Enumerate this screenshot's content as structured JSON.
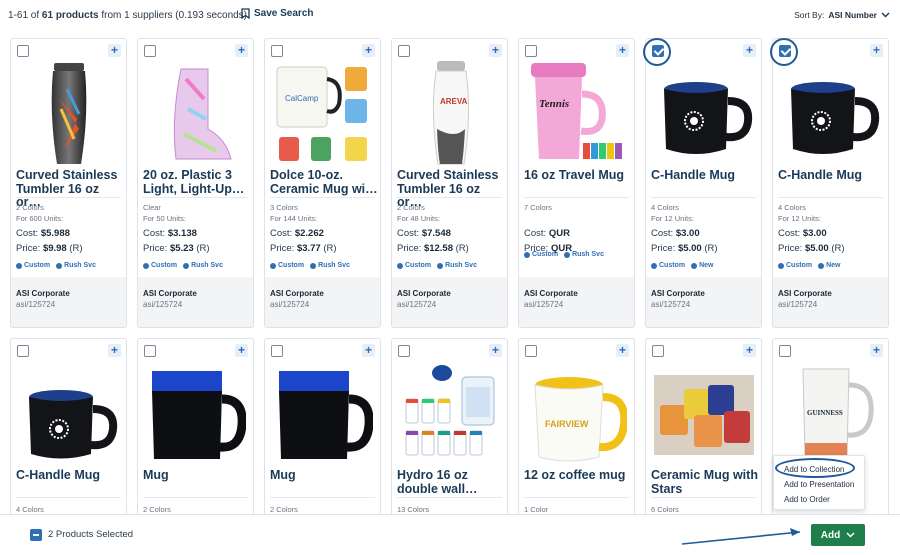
{
  "header": {
    "results_range": "1-61 of",
    "results_count": "61 products",
    "results_suffix": "from 1 suppliers (0.193 seconds)",
    "save_search_label": "Save Search",
    "sort_label": "Sort By:",
    "sort_value": "ASI Number"
  },
  "products": [
    {
      "title": "Curved Stainless Tumbler 16 oz or…",
      "colors": "2 Colors",
      "units": "For 600 Units:",
      "cost_label": "Cost:",
      "cost": "$5.988",
      "price_label": "Price:",
      "price": "$9.98",
      "price_note": "(R)",
      "tags": [
        "Custom",
        "Rush Svc"
      ],
      "supplier": "ASI Corporate",
      "asi": "asi/125724",
      "checked": false
    },
    {
      "title": "20 oz. Plastic 3 Light, Light-Up…",
      "colors": "Clear",
      "units": "For 50 Units:",
      "cost_label": "Cost:",
      "cost": "$3.138",
      "price_label": "Price:",
      "price": "$5.23",
      "price_note": "(R)",
      "tags": [
        "Custom",
        "Rush Svc"
      ],
      "supplier": "ASI Corporate",
      "asi": "asi/125724",
      "checked": false
    },
    {
      "title": "Dolce 10-oz. Ceramic Mug wi…",
      "colors": "3 Colors",
      "units": "For 144 Units:",
      "cost_label": "Cost:",
      "cost": "$2.262",
      "price_label": "Price:",
      "price": "$3.77",
      "price_note": "(R)",
      "tags": [
        "Custom",
        "Rush Svc"
      ],
      "supplier": "ASI Corporate",
      "asi": "asi/125724",
      "checked": false
    },
    {
      "title": "Curved Stainless Tumbler 16 oz or…",
      "colors": "2 Colors",
      "units": "For 48 Units:",
      "cost_label": "Cost:",
      "cost": "$7.548",
      "price_label": "Price:",
      "price": "$12.58",
      "price_note": "(R)",
      "tags": [
        "Custom",
        "Rush Svc"
      ],
      "supplier": "ASI Corporate",
      "asi": "asi/125724",
      "checked": false
    },
    {
      "title": "16 oz Travel Mug",
      "colors": "7 Colors",
      "units": "",
      "cost_label": "Cost:",
      "cost": "QUR",
      "price_label": "Price:",
      "price": "QUR",
      "price_note": "",
      "tags": [
        "Custom",
        "Rush Svc"
      ],
      "supplier": "ASI Corporate",
      "asi": "asi/125724",
      "checked": false
    },
    {
      "title": "C-Handle Mug",
      "colors": "4 Colors",
      "units": "For 12 Units:",
      "cost_label": "Cost:",
      "cost": "$3.00",
      "price_label": "Price:",
      "price": "$5.00",
      "price_note": "(R)",
      "tags": [
        "Custom",
        "New"
      ],
      "supplier": "ASI Corporate",
      "asi": "asi/125724",
      "checked": true
    },
    {
      "title": "C-Handle Mug",
      "colors": "4 Colors",
      "units": "For 12 Units:",
      "cost_label": "Cost:",
      "cost": "$3.00",
      "price_label": "Price:",
      "price": "$5.00",
      "price_note": "(R)",
      "tags": [
        "Custom",
        "New"
      ],
      "supplier": "ASI Corporate",
      "asi": "asi/125724",
      "checked": true
    },
    {
      "title": "C-Handle Mug",
      "colors": "4 Colors"
    },
    {
      "title": "Mug",
      "colors": "2 Colors"
    },
    {
      "title": "Mug",
      "colors": "2 Colors"
    },
    {
      "title": "Hydro 16 oz double wall…",
      "colors": "13 Colors"
    },
    {
      "title": "12 oz coffee mug",
      "colors": "1 Color"
    },
    {
      "title": "Ceramic Mug with Stars",
      "colors": "6 Colors"
    },
    {
      "title": "",
      "colors": ""
    }
  ],
  "image_texts": {
    "p3_logo": "CalCamp",
    "p4_logo": "AREVA",
    "p5_logo": "Tennis",
    "p12_logo": "FAIRVIEW",
    "p14_logo": "GUINNESS"
  },
  "add_menu": {
    "items": [
      "Add to Collection",
      "Add to Presentation",
      "Add to Order"
    ]
  },
  "bottom_bar": {
    "selected_text": "2 Products Selected",
    "add_label": "Add"
  },
  "colors": {
    "accent_blue": "#2f6fb3",
    "title_navy": "#1b3a57",
    "add_green": "#1f7f4c",
    "annotation_blue": "#1e5a9c"
  }
}
